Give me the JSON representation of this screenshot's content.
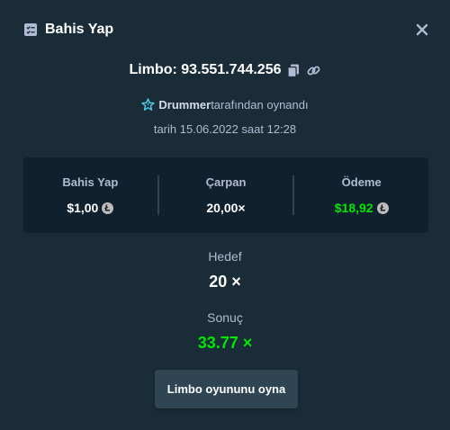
{
  "modal": {
    "title": "Bahis Yap",
    "title_icon": "bet-slip-icon",
    "close_icon": "close-icon"
  },
  "game": {
    "id_text": "Limbo: 93.551.744.256",
    "copy_icon": "copy-icon",
    "link_icon": "link-icon"
  },
  "player": {
    "icon": "star-badge-icon",
    "name": "Drummer",
    "suffix": "tarafından oynandı"
  },
  "date_text": "tarih 15.06.2022 saat 12:28",
  "stats": {
    "bet": {
      "label": "Bahis Yap",
      "value": "$1,00"
    },
    "multiplier": {
      "label": "Çarpan",
      "value": "20,00×"
    },
    "payout": {
      "label": "Ödeme",
      "value": "$18,92"
    }
  },
  "target": {
    "label": "Hedef",
    "value": "20 ×"
  },
  "result": {
    "label": "Sonuç",
    "value": "33.77 ×"
  },
  "play_button_label": "Limbo oyununu oyna",
  "colors": {
    "background": "#1a2c38",
    "panel": "#0f212e",
    "button": "#2f4553",
    "muted_text": "#b1bad3",
    "win_green": "#00e701"
  }
}
